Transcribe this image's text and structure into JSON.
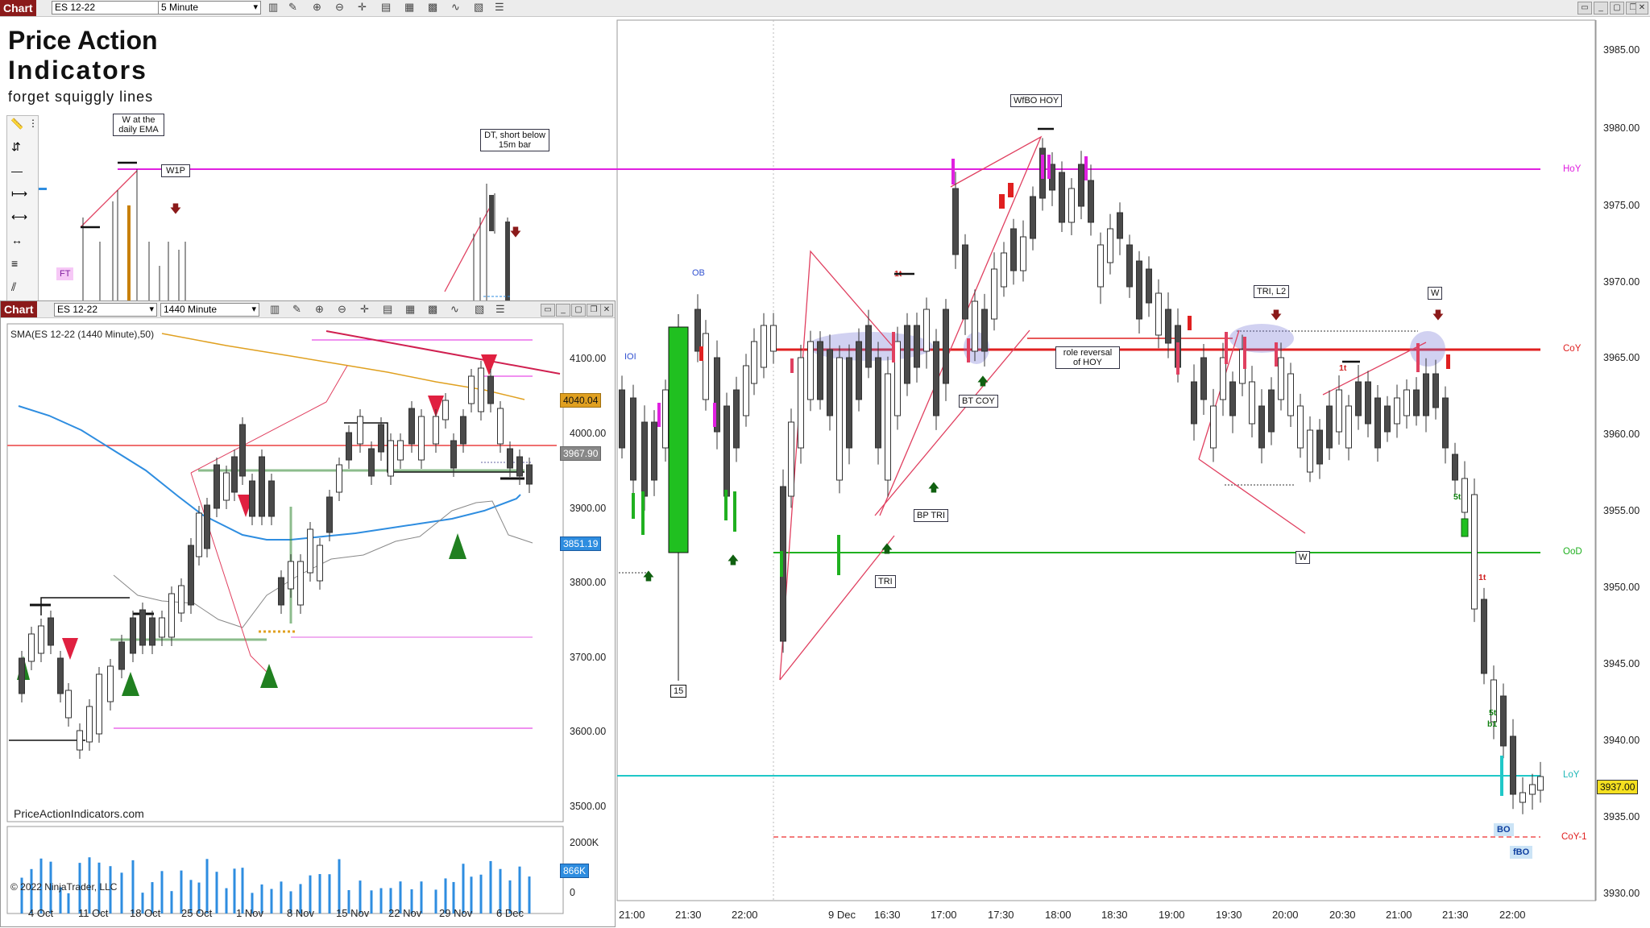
{
  "main_toolbar": {
    "chart_label": "Chart",
    "instrument": "ES 12-22",
    "interval": "5 Minute"
  },
  "logo": {
    "line1": "Price Action",
    "line2": "Indicators",
    "tagline": "forget squiggly lines"
  },
  "main_chart": {
    "y_ticks": [
      "3985.00",
      "3980.00",
      "3975.00",
      "3970.00",
      "3965.00",
      "3960.00",
      "3955.00",
      "3950.00",
      "3945.00",
      "3940.00",
      "3935.00",
      "3930.00"
    ],
    "x_ticks": [
      "21:00",
      "21:30",
      "22:00",
      "9 Dec",
      "16:30",
      "17:00",
      "17:30",
      "18:00",
      "18:30",
      "19:00",
      "19:30",
      "20:00",
      "20:30",
      "21:00",
      "21:30",
      "22:00"
    ],
    "last_price": "3937.00",
    "levels": {
      "hoy": "HoY",
      "coy": "CoY",
      "ood": "OoD",
      "loy": "LoY",
      "coy1": "CoY-1"
    },
    "annotations": {
      "w_daily": "W at the daily EMA",
      "w1p": "W1P",
      "ft": "FT",
      "dt_short": "DT, short below 15m bar",
      "wfbo": "WfBO HOY",
      "ob": "OB",
      "ioi": "IOI",
      "tri_l2": "TRI, L2",
      "w_top": "W",
      "role_reversal": "role reversal of HOY",
      "bt_coy": "BT COY",
      "bp_tri": "BP TRI",
      "tri": "TRI",
      "w_mid": "W",
      "fifteen": "15",
      "bo": "BO",
      "fbo": "fBO",
      "five_t": "5t",
      "five_t_b1": "5t b1",
      "one_t": "1t"
    }
  },
  "daily_window": {
    "chart_label": "Chart",
    "instrument": "ES 12-22",
    "interval": "1440 Minute",
    "indicator_title": "SMA(ES 12-22 (1440 Minute),50)",
    "y_ticks": [
      "4100.00",
      "4000.00",
      "3900.00",
      "3800.00",
      "3700.00",
      "3600.00",
      "3500.00"
    ],
    "x_ticks": [
      "4 Oct",
      "11 Oct",
      "18 Oct",
      "25 Oct",
      "1 Nov",
      "8 Nov",
      "15 Nov",
      "22 Nov",
      "29 Nov",
      "6 Dec"
    ],
    "price_tags": {
      "orange": "4040.04",
      "gray": "3967.90",
      "blue": "3851.19"
    },
    "website": "PriceActionIndicators.com",
    "volume_ticks": [
      "2000K",
      "0"
    ],
    "volume_tag": "866K",
    "copyright": "© 2022 NinjaTrader, LLC"
  },
  "colors": {
    "hoy": "#e020e0",
    "coy": "#e02020",
    "ood": "#20b020",
    "loy": "#20c8c8",
    "ema_blue": "#2e8de0",
    "sma_orange": "#e0a020",
    "bar_dark": "#444444"
  }
}
